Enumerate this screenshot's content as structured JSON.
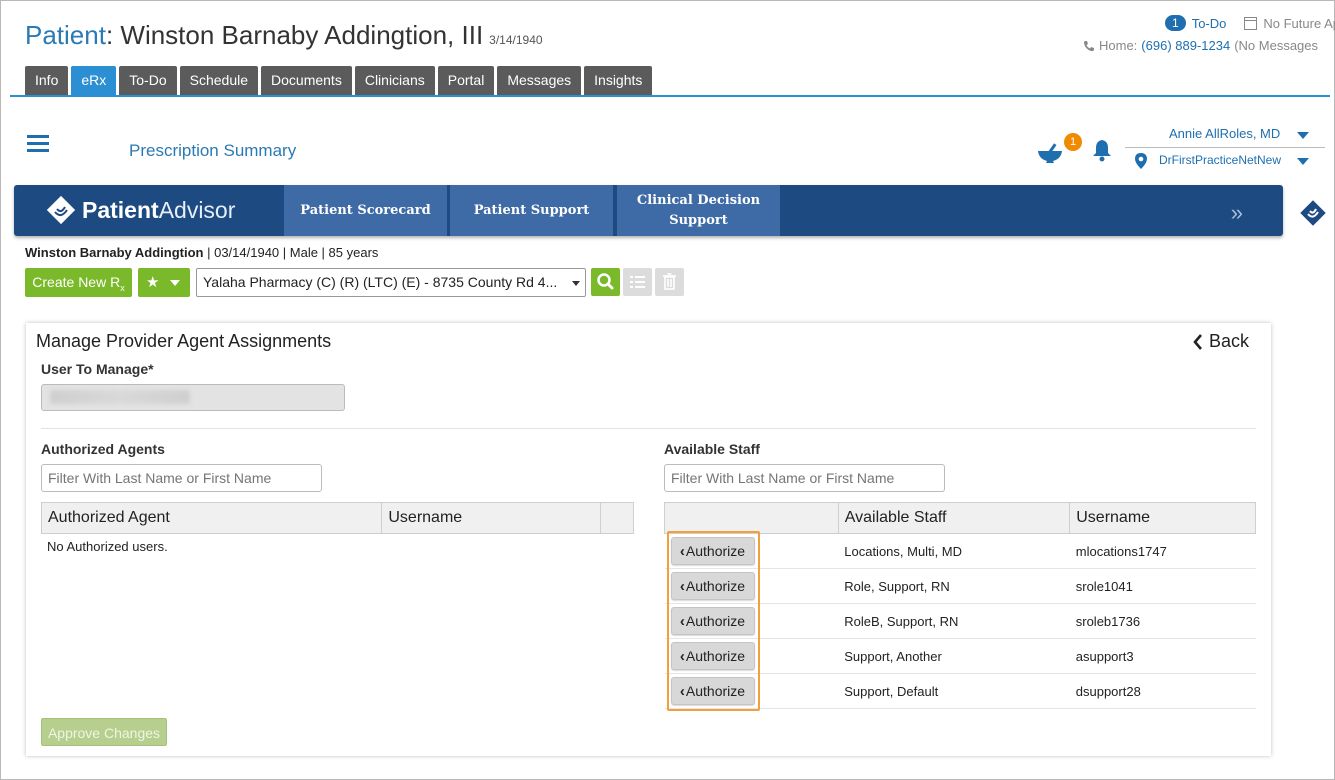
{
  "patient": {
    "label": "Patient",
    "name": ": Winston Barnaby Addingtion, III",
    "dob": "3/14/1940"
  },
  "top_right": {
    "todo_count": "1",
    "todo_label": "To-Do",
    "appt_label": "No Future App",
    "phone_label": "Home:",
    "phone_number": "(696) 889-1234",
    "messages_label": "(No Messages"
  },
  "tabs": [
    "Info",
    "eRx",
    "To-Do",
    "Schedule",
    "Documents",
    "Clinicians",
    "Portal",
    "Messages",
    "Insights"
  ],
  "active_tab": "eRx",
  "toolbar": {
    "title": "Prescription Summary",
    "mortar_badge": "1",
    "user_name": "Annie AllRoles, MD",
    "practice": "DrFirstPracticeNetNew"
  },
  "patient_advisor": {
    "logo_bold": "Patient",
    "logo_light": "Advisor",
    "tabs": [
      "Patient Scorecard",
      "Patient Support",
      "Clinical Decision Support"
    ],
    "forward_icon": "double-chevron-right"
  },
  "patient_info": {
    "name": "Winston Barnaby Addingtion",
    "details": " | 03/14/1940 | Male | 85 years"
  },
  "rx_toolbar": {
    "create_label": "Create New R",
    "create_sub": "x",
    "pharmacy": "Yalaha Pharmacy (C) (R) (LTC) (E) - 8735 County Rd 4..."
  },
  "manage": {
    "title": "Manage Provider Agent Assignments",
    "back_label": "Back",
    "user_label": "User To Manage*",
    "authorized_title": "Authorized Agents",
    "authorized_filter_placeholder": "Filter With Last Name or First Name",
    "authorized_columns": [
      "Authorized Agent",
      "Username"
    ],
    "no_users": "No Authorized users.",
    "available_title": "Available Staff",
    "available_filter_placeholder": "Filter With Last Name or First Name",
    "available_columns": [
      "",
      "Available Staff",
      "Username"
    ],
    "authorize_label": "Authorize",
    "staff": [
      {
        "name": "Locations, Multi, MD",
        "username": "mlocations1747"
      },
      {
        "name": "Role, Support, RN",
        "username": "srole1041"
      },
      {
        "name": "RoleB, Support, RN",
        "username": "sroleb1736"
      },
      {
        "name": "Support, Another",
        "username": "asupport3"
      },
      {
        "name": "Support, Default",
        "username": "dsupport28"
      }
    ],
    "approve_label": "Approve Changes"
  },
  "colors": {
    "accent_blue": "#2c8fd4",
    "link_blue": "#1f6fb0",
    "green": "#7ab929",
    "pa_navy": "#1e4a82",
    "highlight_orange": "#f0a040"
  }
}
